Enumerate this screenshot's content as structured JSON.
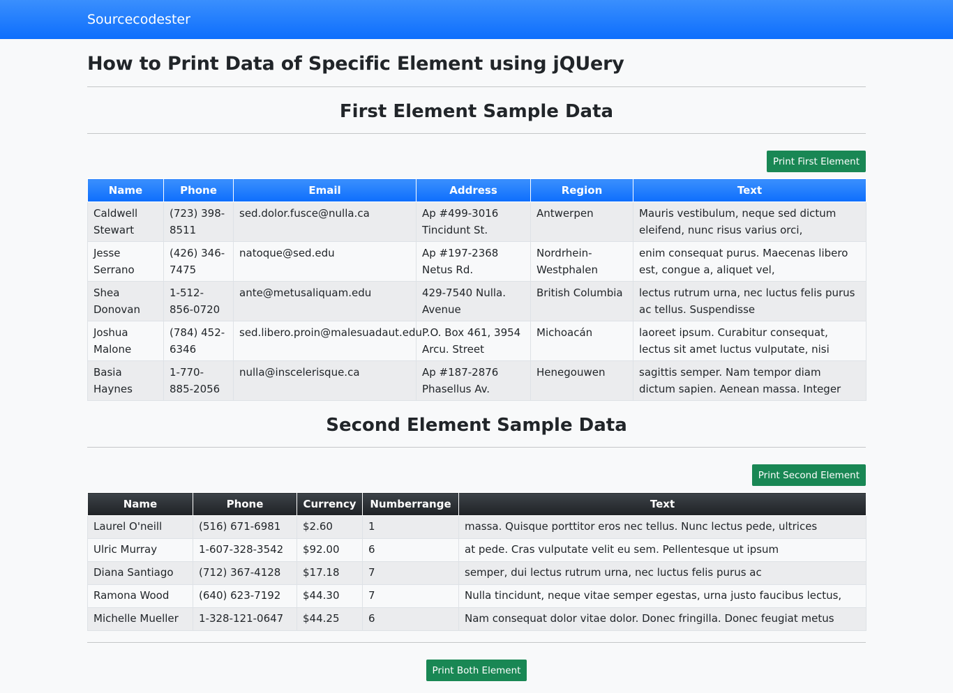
{
  "navbar": {
    "brand": "Sourcecodester"
  },
  "page": {
    "title": "How to Print Data of Specific Element using jQUery"
  },
  "first": {
    "title": "First Element Sample Data",
    "button": "Print First Element",
    "headers": [
      "Name",
      "Phone",
      "Email",
      "Address",
      "Region",
      "Text"
    ],
    "rows": [
      [
        "Caldwell Stewart",
        "(723) 398-8511",
        "sed.dolor.fusce@nulla.ca",
        "Ap #499-3016 Tincidunt St.",
        "Antwerpen",
        "Mauris vestibulum, neque sed dictum eleifend, nunc risus varius orci,"
      ],
      [
        "Jesse Serrano",
        "(426) 346-7475",
        "natoque@sed.edu",
        "Ap #197-2368 Netus Rd.",
        "Nordrhein-Westphalen",
        "enim consequat purus. Maecenas libero est, congue a, aliquet vel,"
      ],
      [
        "Shea Donovan",
        "1-512-856-0720",
        "ante@metusaliquam.edu",
        "429-7540 Nulla. Avenue",
        "British Columbia",
        "lectus rutrum urna, nec luctus felis purus ac tellus. Suspendisse"
      ],
      [
        "Joshua Malone",
        "(784) 452-6346",
        "sed.libero.proin@malesuadaut.edu",
        "P.O. Box 461, 3954 Arcu. Street",
        "Michoacán",
        "laoreet ipsum. Curabitur consequat, lectus sit amet luctus vulputate, nisi"
      ],
      [
        "Basia Haynes",
        "1-770-885-2056",
        "nulla@inscelerisque.ca",
        "Ap #187-2876 Phasellus Av.",
        "Henegouwen",
        "sagittis semper. Nam tempor diam dictum sapien. Aenean massa. Integer"
      ]
    ]
  },
  "second": {
    "title": "Second Element Sample Data",
    "button": "Print Second Element",
    "headers": [
      "Name",
      "Phone",
      "Currency",
      "Numberrange",
      "Text"
    ],
    "rows": [
      [
        "Laurel O'neill",
        "(516) 671-6981",
        "$2.60",
        "1",
        "massa. Quisque porttitor eros nec tellus. Nunc lectus pede, ultrices"
      ],
      [
        "Ulric Murray",
        "1-607-328-3542",
        "$92.00",
        "6",
        "at pede. Cras vulputate velit eu sem. Pellentesque ut ipsum"
      ],
      [
        "Diana Santiago",
        "(712) 367-4128",
        "$17.18",
        "7",
        "semper, dui lectus rutrum urna, nec luctus felis purus ac"
      ],
      [
        "Ramona Wood",
        "(640) 623-7192",
        "$44.30",
        "7",
        "Nulla tincidunt, neque vitae semper egestas, urna justo faucibus lectus,"
      ],
      [
        "Michelle Mueller",
        "1-328-121-0647",
        "$44.25",
        "6",
        "Nam consequat dolor vitae dolor. Donec fringilla. Donec feugiat metus"
      ]
    ]
  },
  "both_button": "Print Both Element"
}
